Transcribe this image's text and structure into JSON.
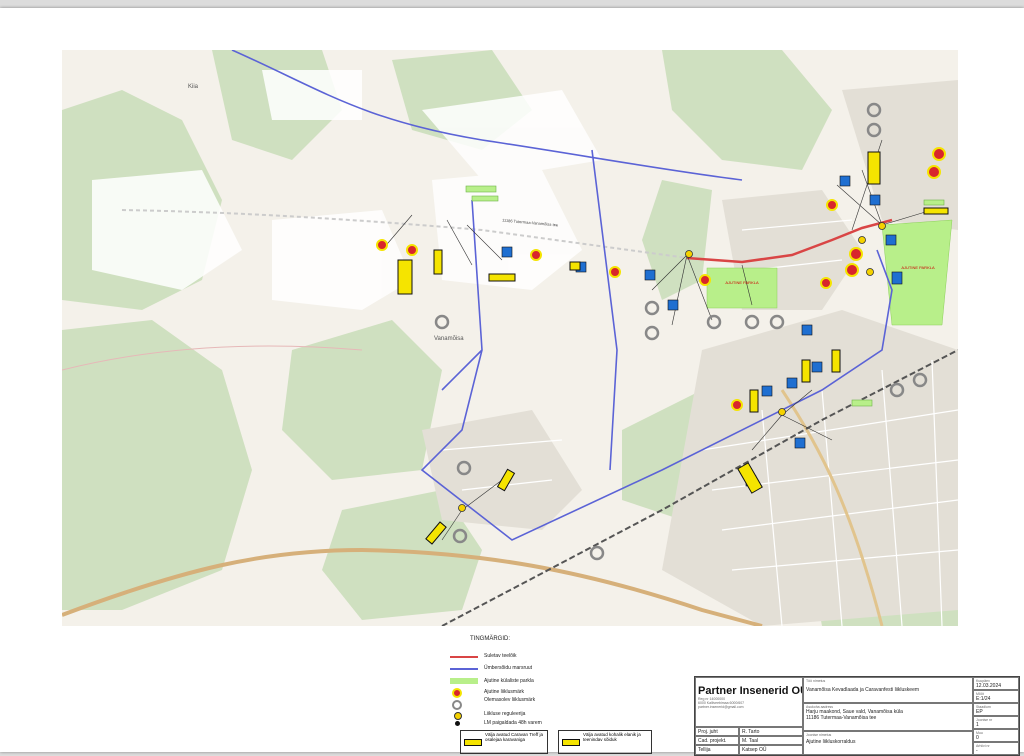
{
  "map": {
    "places": {
      "kiia": "Kiia",
      "vanamoisa": "Vanamõisa",
      "road_11186": "11186 Tutermaa-Vanamõisa tee",
      "parking_a": "AJUTINE PARKLA",
      "parking_b": "AJUTINE PARKLA"
    }
  },
  "legend": {
    "title": "TINGMÄRGID:",
    "items": {
      "closed_road": "Suletav teelõik",
      "detour": "Ümbersõidu marsruut",
      "temp_parking": "Ajutine külaliste parkla",
      "temp_sign": "Ajutine liiklusmärk",
      "existing_sign": "Olemasolev liiklusmärk",
      "regulator": "Liikluse reguleerija",
      "lm_place": "LM paigaldada 48h varem",
      "caravan_open": "Välja avatud Caravan Treff ja osalejaa karavaniga",
      "local_open": "Välja avatud kohalik elanik ja teenindav sõiduk"
    },
    "colors": {
      "closed": "#d94545",
      "detour": "#5b63d6",
      "parking": "#b8ef8a",
      "sign_yellow": "#f5e400",
      "sign_red": "#d8262c",
      "sign_blue": "#1f6fd1"
    }
  },
  "titleblock": {
    "company": "Partner Insenerid OÜ",
    "company_info": [
      "Reg nr 14000000",
      "6000 Kalliveebimaa 6000/607",
      "partner.insenerid@gmail.com"
    ],
    "proj_label": "Proj. juht",
    "proj_value": "R. Tarto",
    "cad_label": "Cad. projekt.",
    "cad_value": "M. Taal",
    "client_label": "Tellija",
    "client_value": "Katsep OÜ",
    "work_small": "Töö nimetus",
    "work_title": "Vanamõisa Kevadlaada ja Caravanfesti liikluskeem",
    "address_small": "Asukoha aadress",
    "address_1": "Harju maakond, Saue vald, Vanamõisa küla",
    "address_2": "11186 Tutermaa-Vanamõisa tee",
    "drawing_small": "Joonise nimetus",
    "drawing_title": "Ajutine liikluskorraldus",
    "date_small": "Kuupäev",
    "date": "12.03.2024",
    "scale_small": "Mõõt",
    "scale": "E:1/24",
    "stage_small": "Staadium",
    "stage": "EP",
    "sheet_small": "Joonise nr",
    "sheet": "1",
    "rev_small": "Muu",
    "rev": "0",
    "extra_small": "Arhiivi nr",
    "extra": "-"
  }
}
